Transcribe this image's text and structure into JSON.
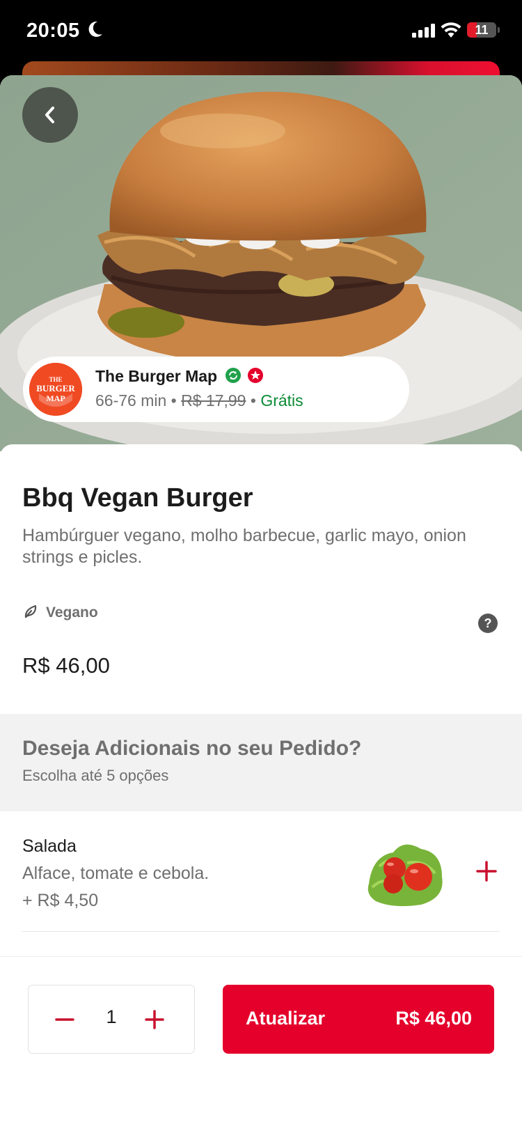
{
  "status_bar": {
    "time": "20:05",
    "battery": "11"
  },
  "store": {
    "name": "The Burger Map",
    "eta": "66-76 min",
    "old_fee": "R$ 17,99",
    "fee": "Grátis",
    "logo_text": "THE BURGER MAP",
    "separator": "•"
  },
  "product": {
    "title": "Bbq Vegan Burger",
    "description": "Hambúrguer vegano, molho barbecue, garlic mayo, onion strings e picles.",
    "tag": "Vegano",
    "price": "R$ 46,00"
  },
  "addons": {
    "title": "Deseja Adicionais no seu Pedido?",
    "subtitle": "Escolha até 5 opções",
    "items": [
      {
        "name": "Salada",
        "description": "Alface, tomate e cebola.",
        "price": "+ R$ 4,50"
      }
    ]
  },
  "footer": {
    "quantity": "1",
    "button_label": "Atualizar",
    "button_price": "R$ 46,00"
  },
  "colors": {
    "accent": "#e4002b",
    "free": "#0a8a34"
  }
}
